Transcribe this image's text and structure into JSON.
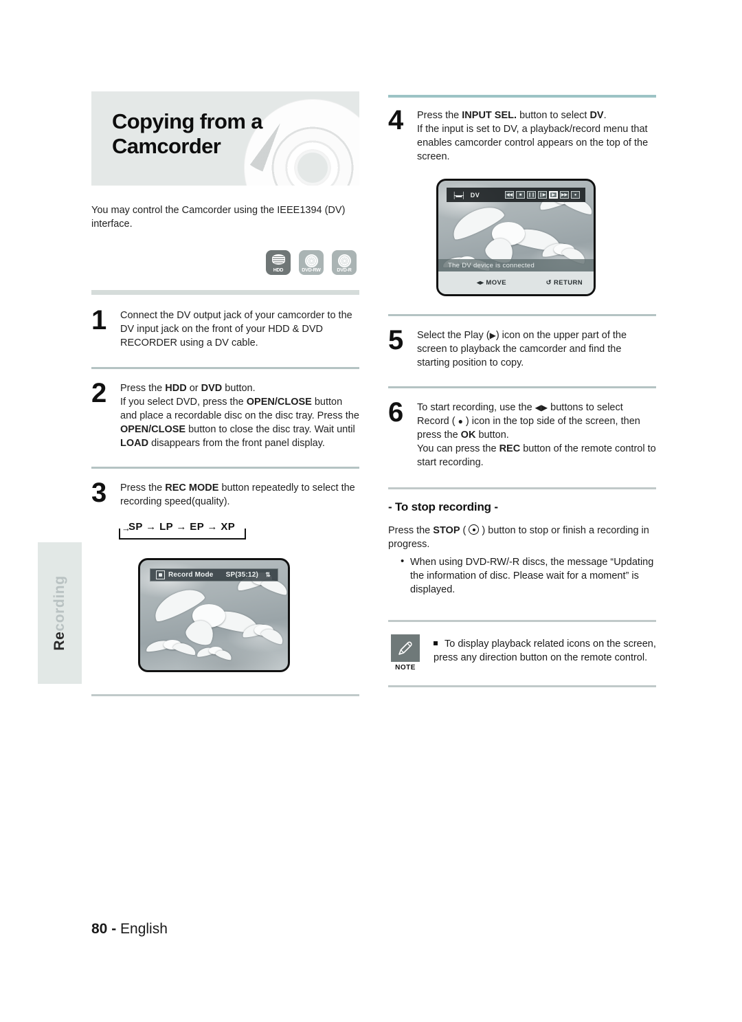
{
  "sidetab": {
    "lead": "Re",
    "rest": "cording"
  },
  "chapter": {
    "title": "Copying from a Camcorder",
    "intro": "You may control the Camcorder using the IEEE1394 (DV) interface."
  },
  "media_badges": [
    {
      "name": "hdd-badge",
      "label": "HDD",
      "icon": "hdd-icon",
      "style": "dark"
    },
    {
      "name": "dvd-rw-badge",
      "label": "DVD-RW",
      "icon": "disc-icon",
      "style": "light"
    },
    {
      "name": "dvd-r-badge",
      "label": "DVD-R",
      "icon": "disc-icon",
      "style": "light"
    }
  ],
  "steps_left": [
    {
      "num": "1",
      "lines": [
        "Connect the DV output jack of your camcorder to the DV input jack on the front of your HDD & DVD RECORDER using a DV cable."
      ]
    },
    {
      "num": "2",
      "lines": [
        "Press the HDD or DVD button.",
        "If you select DVD, press the OPEN/CLOSE button and place a recordable disc on the disc tray. Press the OPEN/CLOSE button to close the disc tray. Wait until LOAD disappears from the front panel display."
      ]
    },
    {
      "num": "3",
      "lines": [
        "Press the REC MODE button repeatedly to select the recording speed(quality)."
      ]
    }
  ],
  "rec_mode_chain": {
    "arrow_in": "→",
    "items": [
      "SP",
      "LP",
      "EP",
      "XP"
    ],
    "separator": "→",
    "text": "SP → LP → EP → XP"
  },
  "tv_record": {
    "osd_label": "Record Mode",
    "osd_value": "SP(35:12)",
    "osd_updown": "⇅",
    "rec_icon": "record-square-icon"
  },
  "steps_right": [
    {
      "num": "4",
      "lines": [
        "Press the INPUT SEL. button to select DV.",
        "If the input is set to DV, a playback/record menu that enables camcorder control appears on the top of the screen."
      ]
    },
    {
      "num": "5",
      "lines": [
        "Select the Play (▶) icon on the upper part of the screen to playback the camcorder and find the starting position to copy."
      ]
    },
    {
      "num": "6",
      "lines": [
        "To start recording, use the ◀▶ buttons to select Record ( ● ) icon in the top side of the screen, then press the OK button.",
        "You can press the REC button of the remote control to start recording."
      ]
    }
  ],
  "tv_dv": {
    "jack_icon": "dv-jack-icon",
    "input_label": "DV",
    "icons": [
      {
        "name": "rewind-icon",
        "glyph": "◀◀",
        "selected": false
      },
      {
        "name": "stop-icon",
        "glyph": "■",
        "selected": false
      },
      {
        "name": "pause-icon",
        "glyph": "❙❙",
        "selected": false
      },
      {
        "name": "step-forward-icon",
        "glyph": "❙▶",
        "selected": false
      },
      {
        "name": "play-icon",
        "glyph": "▶",
        "selected": true
      },
      {
        "name": "fast-forward-icon",
        "glyph": "▶▶",
        "selected": false
      },
      {
        "name": "record-icon",
        "glyph": "●",
        "selected": false
      }
    ],
    "status_text": "The DV device is connected",
    "move_label": "MOVE",
    "move_icon": "◂▸",
    "return_label": "RETURN",
    "return_icon": "↺"
  },
  "stop_section": {
    "heading": "- To stop recording -",
    "paragraph_pre": "Press the ",
    "paragraph_bold": "STOP",
    "paragraph_post": " ) button to stop or finish a recording in progress.",
    "paragraph_full": "Press the STOP ( ⊙ ) button to stop or finish a recording in progress.",
    "bullets": [
      "When using DVD-RW/-R discs, the message “Updating the information of disc. Please wait for a moment” is displayed."
    ]
  },
  "note": {
    "badge_label": "NOTE",
    "badge_icon": "pencil-icon",
    "text": "To display playback related icons on the screen, press any direction button on the remote control."
  },
  "footer": {
    "page": "80 -",
    "language": "English"
  },
  "colors": {
    "header_band": "#e4e8e7",
    "side_tab": "#e2e8e6",
    "rule_teal": "#9cc3c5",
    "rule_gray": "#c0c9c9",
    "rule_thick": "#d5dcda",
    "badge_dark": "#6f7676",
    "badge_light": "#aab4b4",
    "note_badge": "#6f7979"
  }
}
